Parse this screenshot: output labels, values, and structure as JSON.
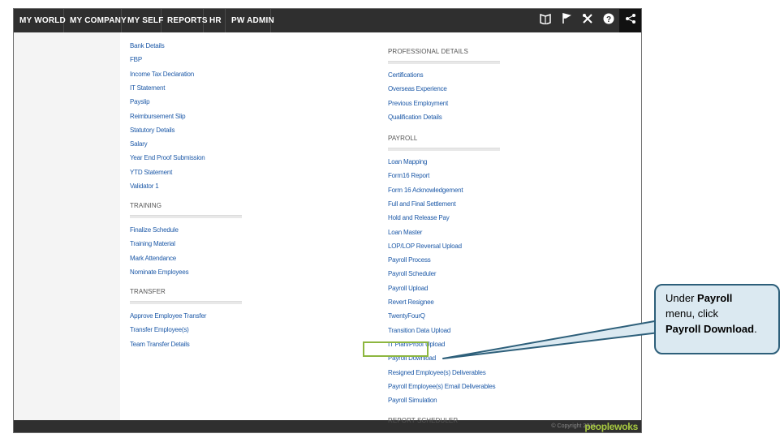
{
  "nav": {
    "items": [
      "MY WORLD",
      "MY COMPANY",
      "MY SELF",
      "REPORTS",
      "HR",
      "PW ADMIN"
    ],
    "icons": [
      "book-icon",
      "flag-icon",
      "tools-icon",
      "help-icon",
      "share-icon"
    ]
  },
  "left_column": {
    "links_a": [
      "Bank Details",
      "FBP",
      "Income Tax Declaration",
      "IT Statement",
      "Payslip",
      "Reimbursement Slip",
      "Statutory Details",
      "Salary",
      "Year End Proof Submission",
      "YTD Statement",
      "Validator 1"
    ],
    "training": {
      "heading": "TRAINING",
      "links": [
        "Finalize Schedule",
        "Training Material",
        "Mark Attendance",
        "Nominate Employees"
      ]
    },
    "transfer": {
      "heading": "TRANSFER",
      "links": [
        "Approve Employee Transfer",
        "Transfer Employee(s)",
        "Team Transfer Details"
      ]
    }
  },
  "right_column": {
    "professional": {
      "heading": "PROFESSIONAL DETAILS",
      "links": [
        "Certifications",
        "Overseas Experience",
        "Previous Employment",
        "Qualification Details"
      ]
    },
    "payroll": {
      "heading": "PAYROLL",
      "links": [
        "Loan Mapping",
        "Form16 Report",
        "Form 16 Acknowledgement",
        "Full and Final Settlement",
        "Hold and Release Pay",
        "Loan Master",
        "LOP/LOP Reversal Upload",
        "Payroll Process",
        "Payroll Scheduler",
        "Payroll Upload",
        "Revert Resignee",
        "TwentyFourQ",
        "Transition Data Upload",
        "IT Plan/Proof Upload",
        "Payroll Download",
        "Resigned Employee(s) Deliverables",
        "Payroll Employee(s) Email Deliverables",
        "Payroll Simulation"
      ]
    },
    "next_heading": "REPORT SCHEDULER"
  },
  "footer": {
    "copyright": "© Copyright 2016",
    "brand": "peoplewoks"
  },
  "callout": {
    "line1": "Under ",
    "bold1": "Payroll",
    "line2": " menu, click ",
    "bold2": "Payroll Download",
    "end": "."
  },
  "colors": {
    "nav_bg": "#2f2f2f",
    "link": "#1e5aa8",
    "highlight": "#8db63f",
    "callout_bg": "#dbe9f1",
    "callout_border": "#2d5f7a"
  }
}
